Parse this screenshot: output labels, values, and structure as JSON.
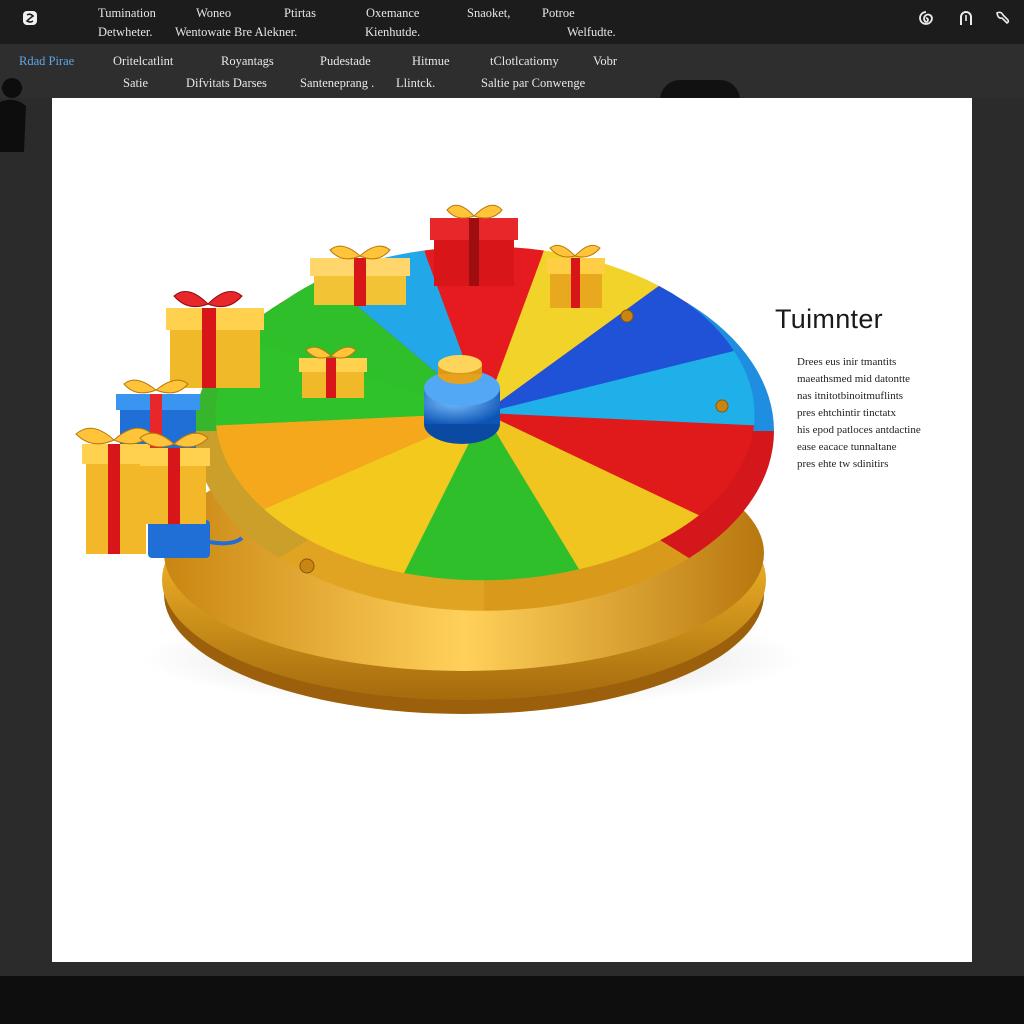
{
  "menubar": {
    "row1": [
      "Tumination",
      "Woneo",
      "Ptirtas",
      "Oxemance",
      "Snaoket,",
      "Potroe"
    ],
    "row2": [
      "Detwheter.",
      "Wentowate Bre Alekner.",
      "Kienhutde.",
      "Welfudte."
    ],
    "app_icon": "app-logo-icon",
    "window_icons": [
      "swirl-icon",
      "horseshoe-icon",
      "wrench-icon"
    ]
  },
  "toolbar": {
    "row1": [
      "Rdad Pirae",
      "Oritelcatlint",
      "Royantags",
      "Pudestade",
      "Hitmue",
      "tClotlcatiomy",
      "Vobr"
    ],
    "row2": [
      "Satie",
      "Difvitats Darses",
      "Santeneprang .",
      "Llintck.",
      "Saltie par Conwenge"
    ]
  },
  "canvas": {
    "title": "Tuimnter",
    "paragraph": [
      "Drees eus inir tmantits",
      "maeathsmed mid datontte",
      "nas itnitotbinoitmuflints",
      "pres ehtchintir tinctatx",
      "his epod patloces antdactine",
      "ease eacace tunnaltane",
      "pres ehte tw sdinitirs"
    ]
  },
  "colors": {
    "menubar_bg": "#1c1c1c",
    "toolbar_bg": "#2e2e2e",
    "active_tab": "#5ea7e6",
    "canvas_bg": "#ffffff",
    "wheel_gold": "#d99a1c",
    "segment_red": "#e0191b",
    "segment_blue": "#1f6fd6",
    "segment_cyan": "#1fb0ea",
    "segment_green": "#2fbf2a",
    "segment_yellow": "#f2c522"
  }
}
